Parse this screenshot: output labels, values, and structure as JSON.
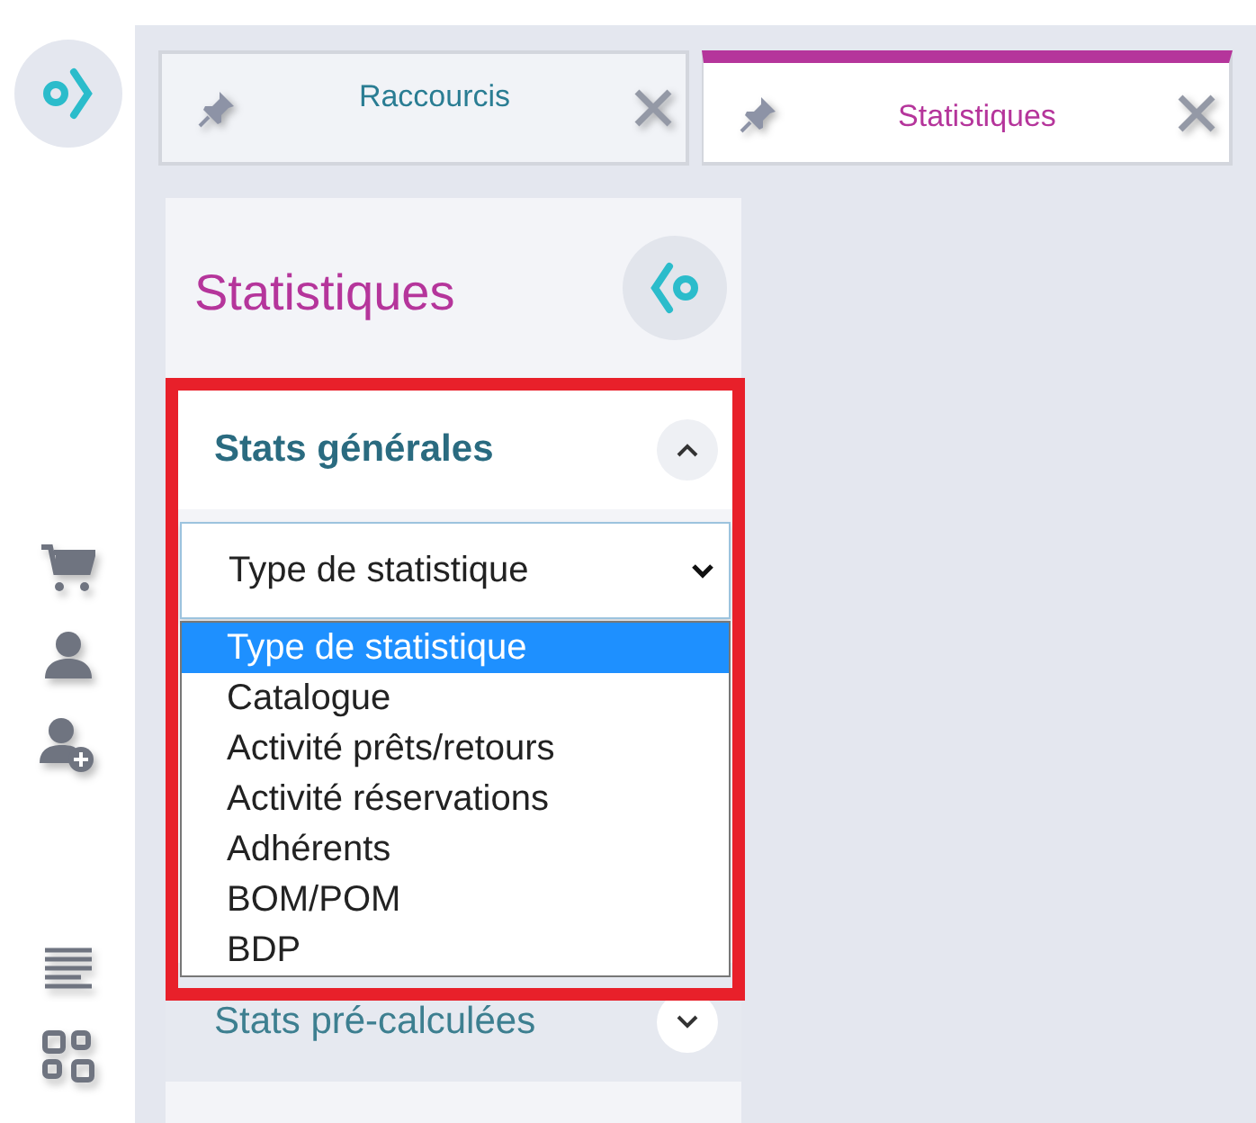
{
  "tabs": [
    {
      "label": "Raccourcis",
      "selected": false
    },
    {
      "label": "Statistiques",
      "selected": true
    }
  ],
  "panel": {
    "title": "Statistiques",
    "sections": [
      {
        "title": "Stats générales",
        "expanded": true,
        "select": {
          "value": "Type de statistique",
          "open": true,
          "options": [
            {
              "label": "Type de statistique",
              "selected": true
            },
            {
              "label": "Catalogue",
              "selected": false
            },
            {
              "label": "Activité prêts/retours",
              "selected": false
            },
            {
              "label": "Activité réservations",
              "selected": false
            },
            {
              "label": "Adhérents",
              "selected": false
            },
            {
              "label": "BOM/POM",
              "selected": false
            },
            {
              "label": "BDP",
              "selected": false
            }
          ]
        }
      },
      {
        "title": "Stats pré-calculées",
        "expanded": false
      }
    ]
  }
}
